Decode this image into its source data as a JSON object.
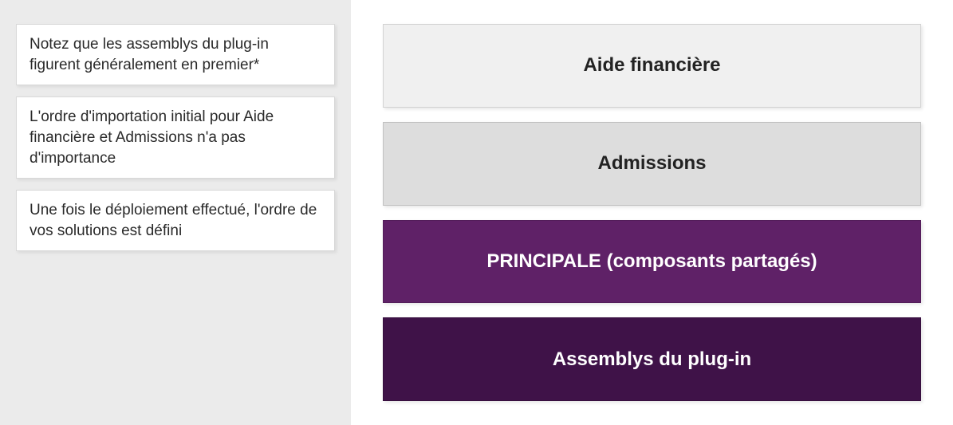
{
  "notes": [
    "Notez que les assemblys du plug-in figurent généralement en premier*",
    "L'ordre d'importation initial pour Aide financière et Admissions n'a pas d'importance",
    "Une fois le déploiement effectué, l'ordre de vos solutions est défini"
  ],
  "solutions": [
    {
      "label": "Aide financière",
      "style": "solution-light1"
    },
    {
      "label": "Admissions",
      "style": "solution-light2"
    },
    {
      "label": "PRINCIPALE (composants partagés)",
      "style": "solution-purple1"
    },
    {
      "label": "Assemblys du plug-in",
      "style": "solution-purple2"
    }
  ],
  "colors": {
    "panel_bg": "#ebebeb",
    "light1": "#f0f0f0",
    "light2": "#dddddd",
    "purple1": "#5f2167",
    "purple2": "#3f1248"
  }
}
